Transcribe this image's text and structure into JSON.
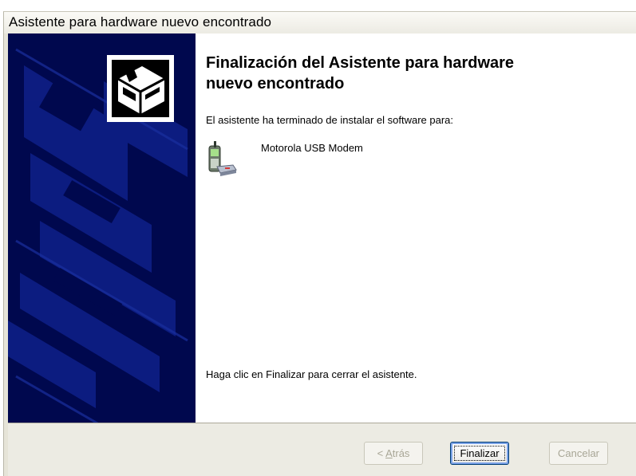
{
  "window": {
    "title": "Asistente para hardware nuevo encontrado"
  },
  "main": {
    "heading": "Finalización del Asistente para hardware nuevo encontrado",
    "intro": "El asistente ha terminado de instalar el software para:",
    "device_name": "Motorola USB Modem",
    "finish_hint": "Haga clic en Finalizar para cerrar el asistente."
  },
  "buttons": {
    "back_prefix": "< ",
    "back_accel": "A",
    "back_rest": "trás",
    "finish": "Finalizar",
    "cancel": "Cancelar",
    "back_disabled": true,
    "cancel_disabled": true
  },
  "icons": {
    "banner": "hardware-wizard-icon",
    "device": "phone-modem-icon"
  },
  "colors": {
    "banner_bg": "#00084e",
    "footer_bg": "#ecebe3",
    "button_border": "#003c74"
  }
}
